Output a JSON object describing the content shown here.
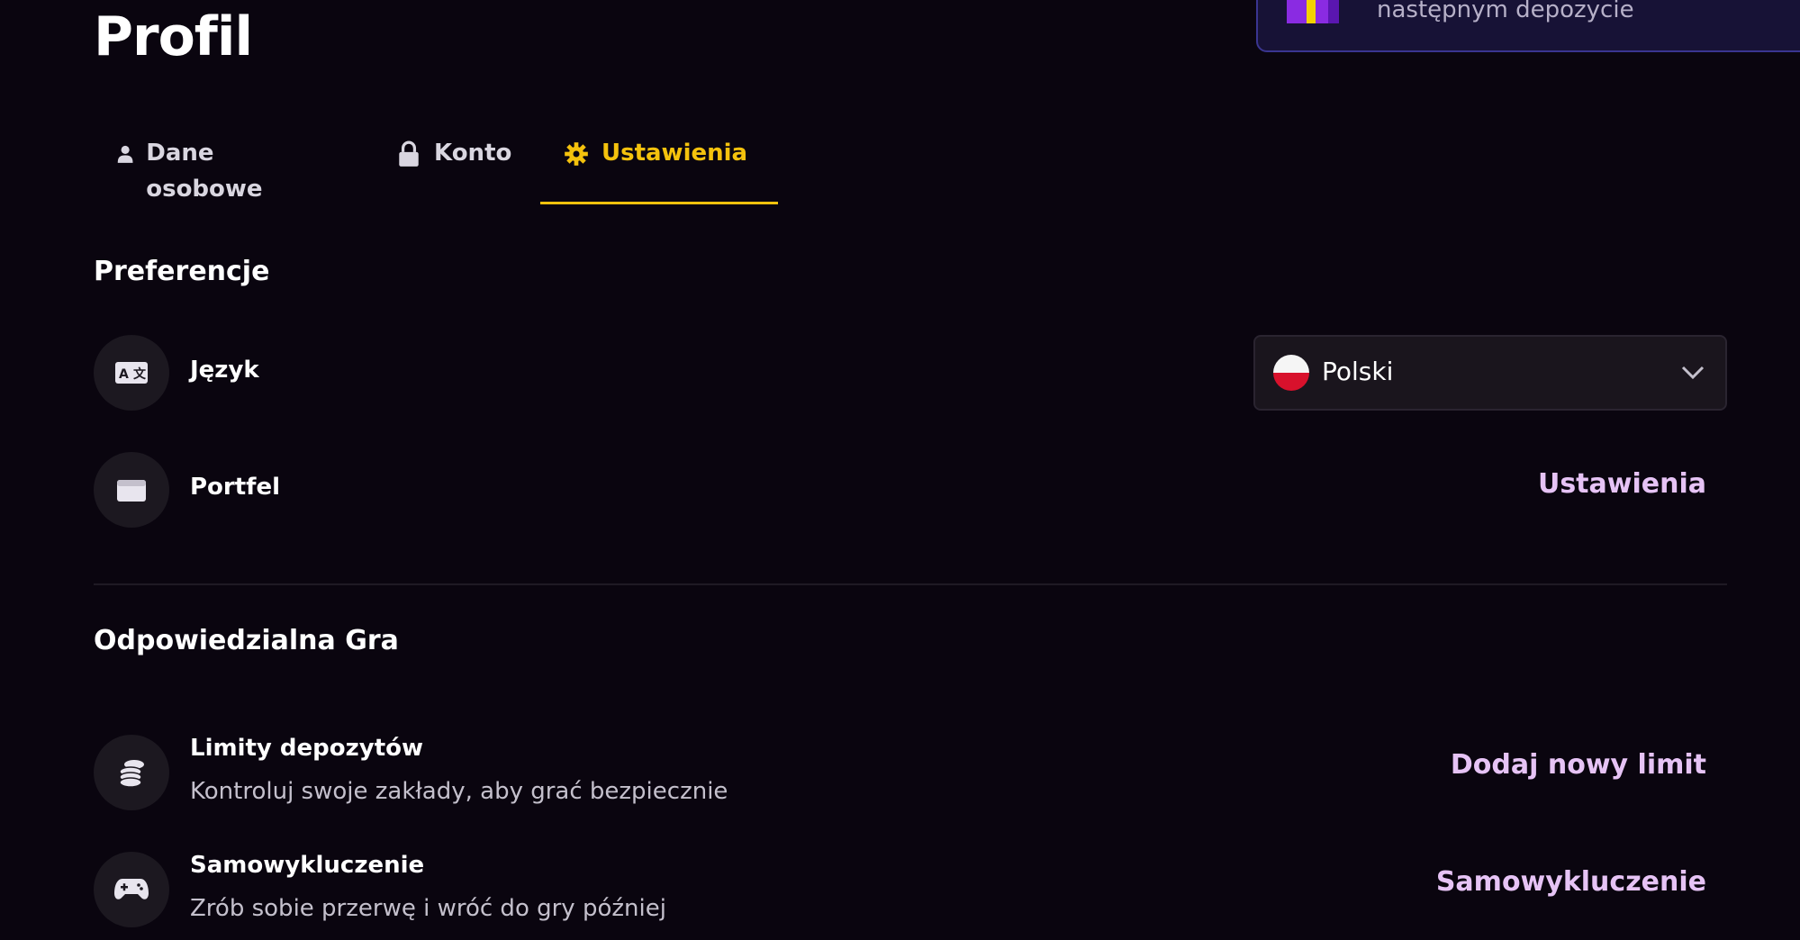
{
  "page": {
    "title": "Profil"
  },
  "promo": {
    "text": "następnym depozycie"
  },
  "tabs": [
    {
      "label": "Dane osobowe",
      "icon": "user-icon",
      "active": false
    },
    {
      "label": "Konto",
      "icon": "lock-icon",
      "active": false
    },
    {
      "label": "Ustawienia",
      "icon": "gear-icon",
      "active": true
    }
  ],
  "preferences": {
    "title": "Preferencje",
    "language": {
      "label": "Język",
      "icon": "language-icon",
      "selected": "Polski",
      "flag": "poland-flag"
    },
    "wallet": {
      "label": "Portfel",
      "icon": "wallet-icon",
      "action": "Ustawienia"
    }
  },
  "responsible": {
    "title": "Odpowiedzialna Gra",
    "deposit_limits": {
      "title": "Limity depozytów",
      "subtitle": "Kontroluj swoje zakłady, aby grać bezpiecznie",
      "icon": "coins-icon",
      "action": "Dodaj nowy limit"
    },
    "self_exclusion": {
      "title": "Samowykluczenie",
      "subtitle": "Zrób sobie przerwę i wróć do gry później",
      "icon": "gamepad-icon",
      "action": "Samowykluczenie"
    }
  },
  "colors": {
    "accent": "#f4c20d",
    "link": "#e6c3f5",
    "background": "#0a050f"
  }
}
